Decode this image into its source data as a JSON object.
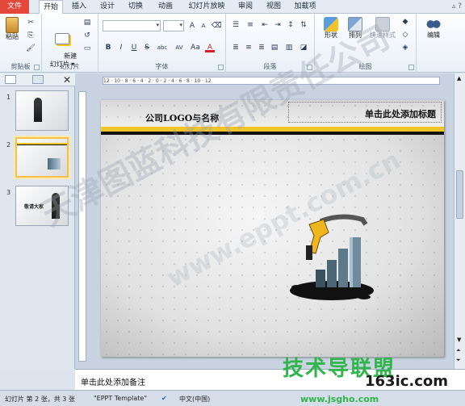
{
  "tabs": [
    "文件",
    "开始",
    "插入",
    "设计",
    "切换",
    "动画",
    "幻灯片放映",
    "审阅",
    "视图",
    "加载项"
  ],
  "ribbon": {
    "clipboard": {
      "label": "剪贴板",
      "paste": "粘贴"
    },
    "slides": {
      "label": "幻灯片",
      "new_slide": "新建\n幻灯片 ▾"
    },
    "font": {
      "label": "字体",
      "size_glyph": "A",
      "bold": "B",
      "italic": "I",
      "underline": "U",
      "strike": "S",
      "shadow": "abc",
      "spacing": "AV",
      "case": "Aa",
      "color": "A"
    },
    "paragraph": {
      "label": "段落"
    },
    "drawing": {
      "label": "绘图",
      "shape": "形状",
      "arrange": "排列",
      "quick_style": "快速样式"
    },
    "editing": {
      "label": "编辑",
      "edit": "编辑"
    }
  },
  "panel": {
    "slides": [
      {
        "num": "1",
        "caption": ""
      },
      {
        "num": "2",
        "caption": ""
      },
      {
        "num": "3",
        "caption": "敬请大家"
      }
    ]
  },
  "ruler": {
    "text": "12 · 10 · 8 · 6 · 4 · 2 · 0 · 2 · 4 · 6 · 8 · 10 · 12"
  },
  "slide": {
    "logo_text": "公司LOGO与名称",
    "title_placeholder": "单击此处添加标题"
  },
  "notes": {
    "placeholder": "单击此处添加备注"
  },
  "status": {
    "slide_info": "幻灯片 第 2 张，共 3 张",
    "template": "\"EPPT Template\"",
    "language": "中文(中国)"
  },
  "watermarks": {
    "company": "天津图蓝科技有限责任公司",
    "site": "www.eppt.com.cn",
    "brand": "技术导联盟",
    "domain1": "163ic.com",
    "domain2": "www.jsgho.com"
  },
  "colors": {
    "file_tab": "#e4483a",
    "stripe_yellow": "#f3c327",
    "stripe_black": "#111111",
    "selection": "#f2c14e"
  }
}
